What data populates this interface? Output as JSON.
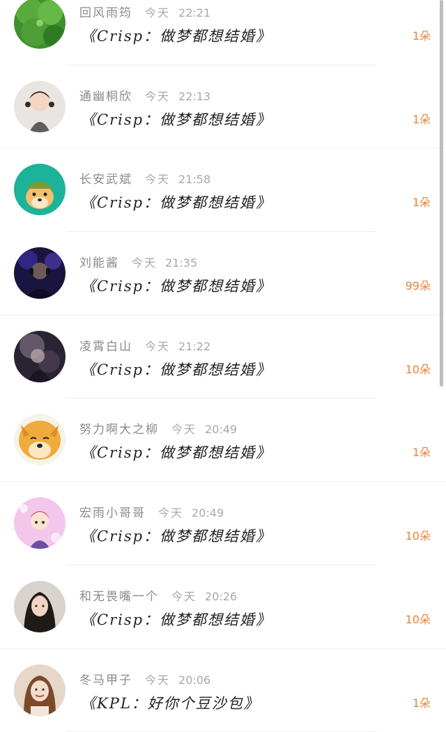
{
  "comments": [
    {
      "user": "回风雨筠",
      "day": "今天",
      "time": "22:21",
      "title": "《Crisp：做梦都想结婚》",
      "count": "1朵",
      "avatar": "clover-avatar"
    },
    {
      "user": "通幽桐欣",
      "day": "今天",
      "time": "22:13",
      "title": "《Crisp：做梦都想结婚》",
      "count": "1朵",
      "avatar": "girl-pigtails-avatar"
    },
    {
      "user": "长安武斌",
      "day": "今天",
      "time": "21:58",
      "title": "《Crisp：做梦都想结婚》",
      "count": "1朵",
      "avatar": "doge-helmet-avatar"
    },
    {
      "user": "刘能酱",
      "day": "今天",
      "time": "21:35",
      "title": "《Crisp：做梦都想结婚》",
      "count": "99朵",
      "avatar": "headphone-dj-avatar"
    },
    {
      "user": "凌霄白山",
      "day": "今天",
      "time": "21:22",
      "title": "《Crisp：做梦都想结婚》",
      "count": "10朵",
      "avatar": "dark-portrait-avatar"
    },
    {
      "user": "努力啊大之柳",
      "day": "今天",
      "time": "20:49",
      "title": "《Crisp：做梦都想结婚》",
      "count": "1朵",
      "avatar": "doge-face-avatar"
    },
    {
      "user": "宏雨小哥哥",
      "day": "今天",
      "time": "20:49",
      "title": "《Crisp：做梦都想结婚》",
      "count": "10朵",
      "avatar": "cartoon-boy-avatar"
    },
    {
      "user": "和无畏嘴一个",
      "day": "今天",
      "time": "20:26",
      "title": "《Crisp：做梦都想结婚》",
      "count": "10朵",
      "avatar": "woman-portrait-avatar"
    },
    {
      "user": "冬马甲子",
      "day": "今天",
      "time": "20:06",
      "title": "《KPL：好你个豆沙包》",
      "count": "1朵",
      "avatar": "girl-smile-avatar"
    }
  ]
}
